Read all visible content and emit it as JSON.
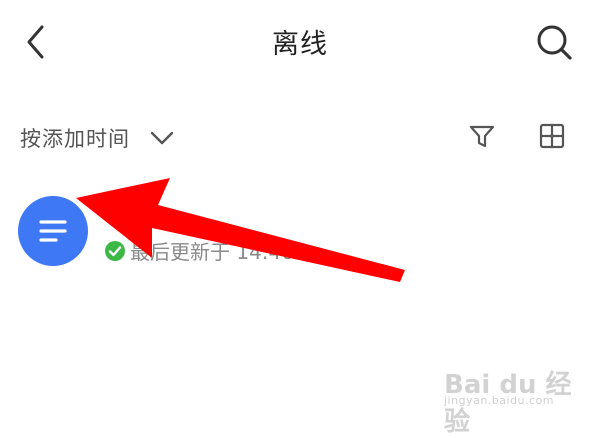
{
  "header": {
    "title": "离线",
    "back_icon": "chevron-left-icon",
    "search_icon": "search-icon"
  },
  "toolbar": {
    "sort_label": "按添加时间",
    "sort_chevron_icon": "chevron-down-icon",
    "filter_icon": "filter-icon",
    "grid_icon": "grid-view-icon"
  },
  "file": {
    "icon": "document-lines-icon",
    "icon_color": "#3E78F5",
    "meta": "最后更新于 14:46",
    "status_icon": "check-circle-icon",
    "status_color": "#3DB847"
  },
  "annotation": {
    "arrow_color": "#FF0000"
  },
  "watermark": {
    "text": "Bai du 经验",
    "url": "jingyan.baidu.com"
  }
}
